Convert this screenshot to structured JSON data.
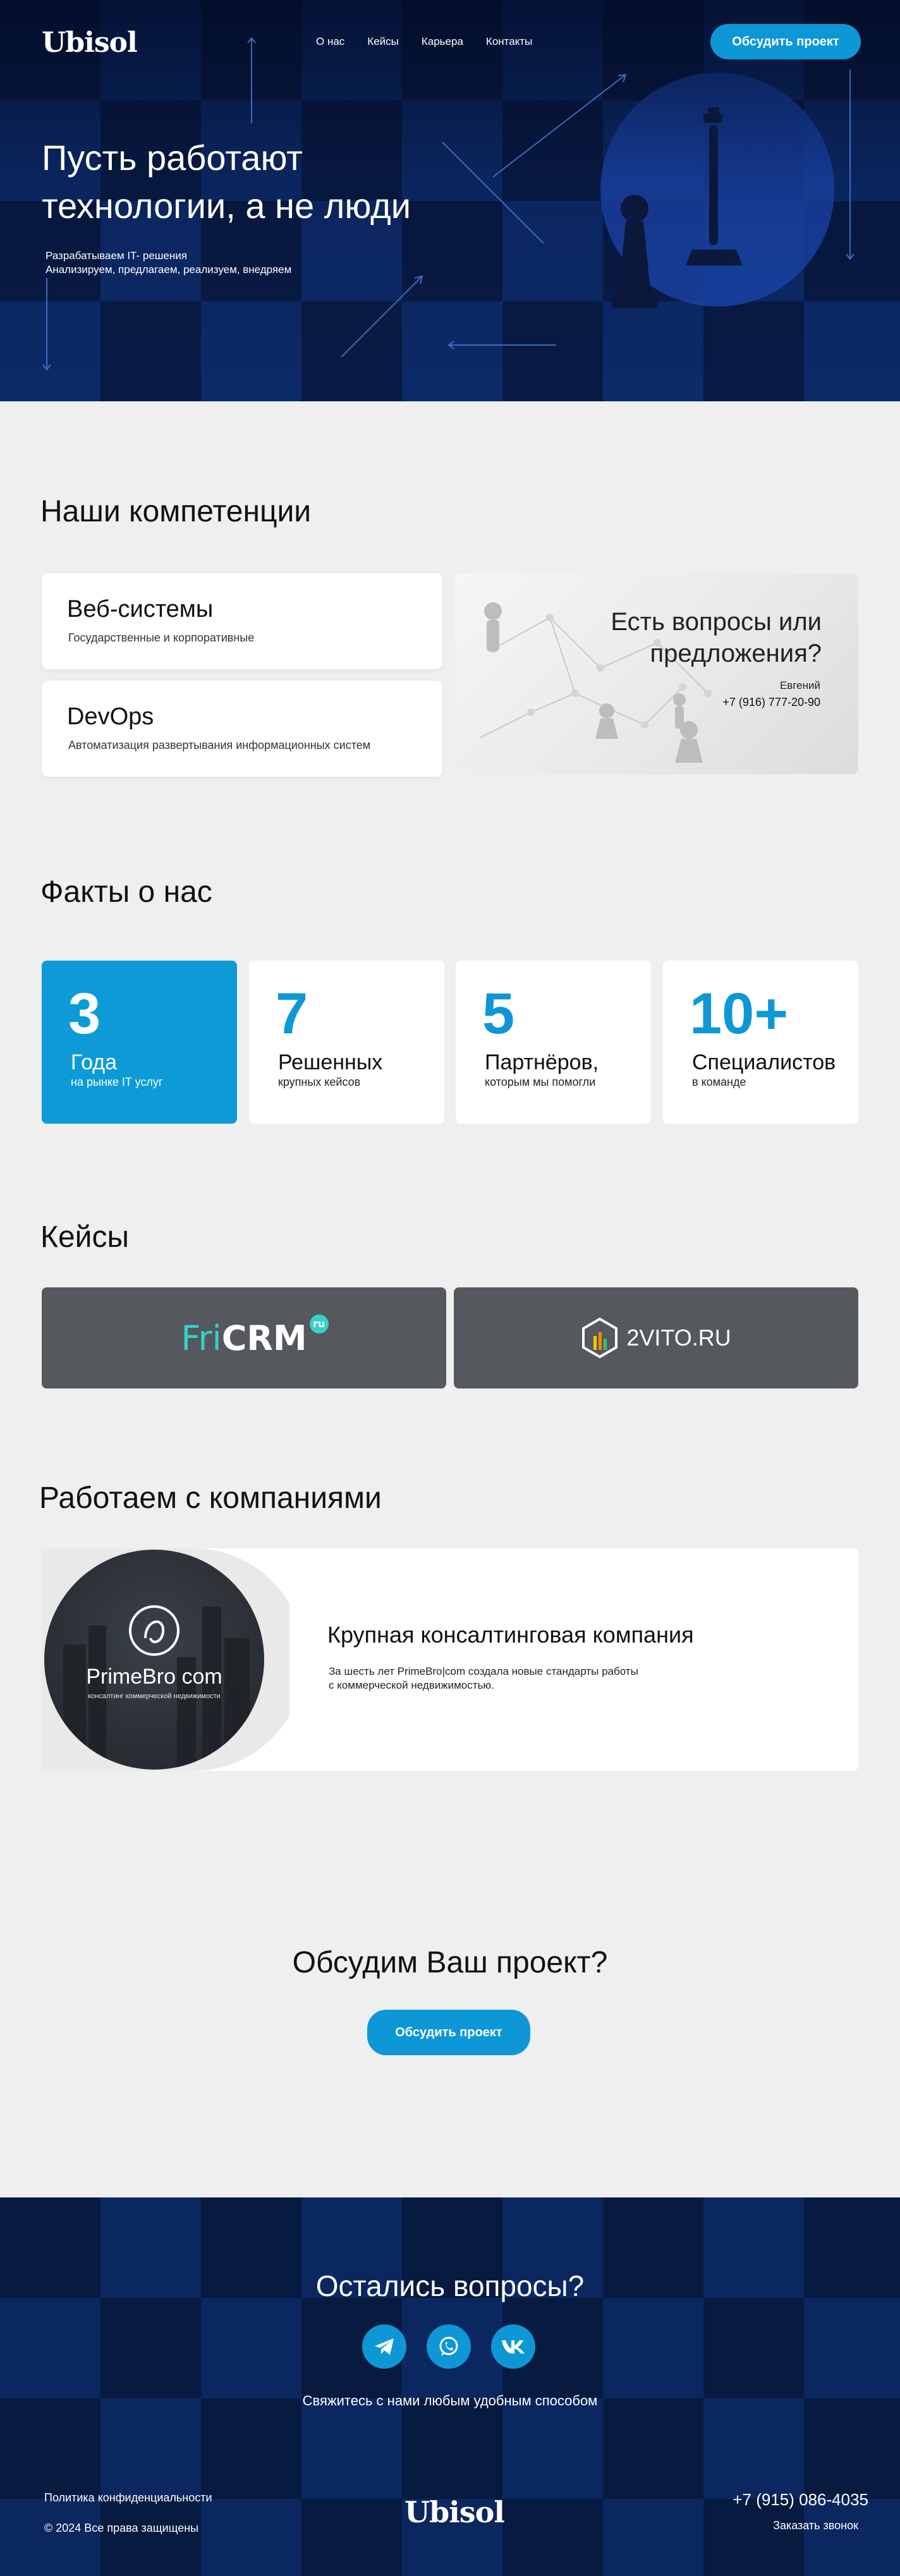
{
  "header": {
    "logo_text": "Ubisol",
    "nav": [
      "О нас",
      "Кейсы",
      "Карьера",
      "Контакты"
    ],
    "cta_label": "Обсудить проект"
  },
  "hero": {
    "title_line1": "Пусть работают",
    "title_line2": "технологии, а не люди",
    "sub_line1": "Разрабатываем IT- решения",
    "sub_line2": "Анализируем, предлагаем, реализуем, внедряем"
  },
  "competencies": {
    "title": "Наши компетенции",
    "items": [
      {
        "title": "Веб-системы",
        "subtitle": "Государственные и корпоративные"
      },
      {
        "title": "DevOps",
        "subtitle": "Автоматизация развертывания информационных систем"
      }
    ],
    "contact": {
      "question_line1": "Есть вопросы или",
      "question_line2": "предложения?",
      "name": "Евгений",
      "phone": "+7 (916) 777-20-90"
    }
  },
  "facts": {
    "title": "Факты о нас",
    "items": [
      {
        "number": "3",
        "label": "Года",
        "sub": "на рынке IT услуг"
      },
      {
        "number": "7",
        "label": "Решенных",
        "sub": "крупных кейсов"
      },
      {
        "number": "5",
        "label": "Партнёров,",
        "sub": "которым мы помогли"
      },
      {
        "number": "10+",
        "label": "Специалистов",
        "sub": "в команде"
      }
    ]
  },
  "cases": {
    "title": "Кейсы",
    "items": [
      {
        "logo_part1": "Fri",
        "logo_part2": "CRM",
        "badge": "ru"
      },
      {
        "logo_text": "2VITO.RU"
      }
    ]
  },
  "partners": {
    "title": "Работаем с компаниями",
    "logo_name": "PrimeBro com",
    "logo_tagline": "консалтинг коммерческой недвижимости",
    "card_title": "Крупная консалтинговая компания",
    "card_desc_line1": "За шесть лет PrimeBro|com создала новые стандарты работы",
    "card_desc_line2": "с коммерческой недвижимостью."
  },
  "cta": {
    "title": "Обсудим Ваш проект?",
    "button": "Обсудить проект"
  },
  "footer": {
    "title": "Остались вопросы?",
    "subtitle": "Свяжитесь с нами любым удобным способом",
    "social_icons": [
      "telegram-icon",
      "whatsapp-icon",
      "vk-icon"
    ],
    "privacy": "Политика конфиденциальности",
    "copyright": "© 2024 Все права защищены",
    "logo_text": "Ubisol",
    "phone": "+7 (915) 086-4035",
    "callback": "Заказать звонок"
  },
  "colors": {
    "accent": "#0d97d6",
    "dark_navy": "#0a1e4a",
    "page_bg": "#efefef",
    "case_bg": "#55585d"
  }
}
